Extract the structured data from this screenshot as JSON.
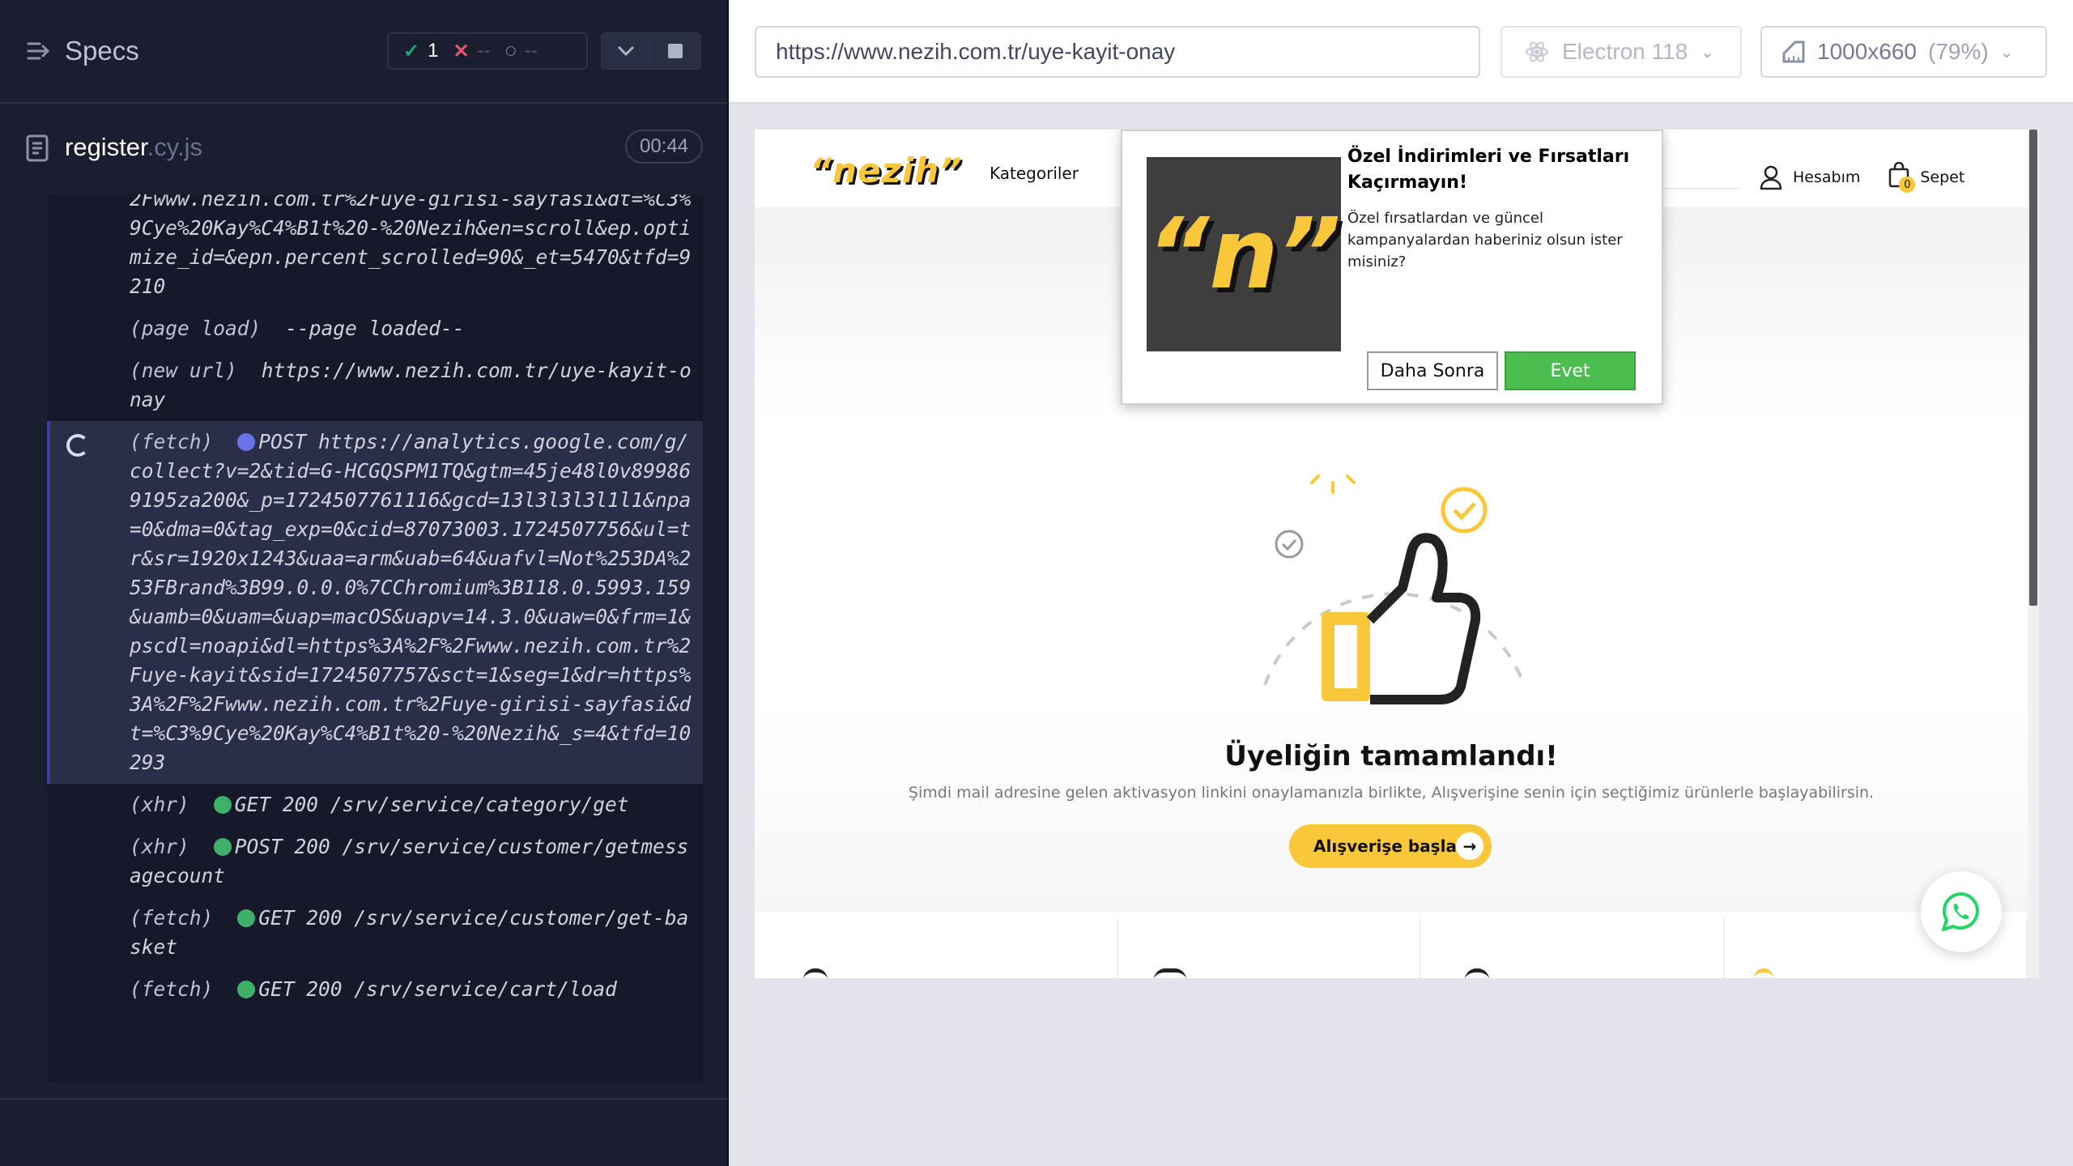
{
  "reporter": {
    "specs_label": "Specs",
    "stats": {
      "passed": "1",
      "failed": "--",
      "pending": "--"
    },
    "spec_file": {
      "name": "register",
      "ext": ".cy.js",
      "duration": "00:44"
    },
    "commands": [
      {
        "name": "",
        "message": "2Fwww.nezih.com.tr%2Fuye-girisi-sayfasi&dt=%C3%9Cye%20Kay%C4%B1t%20-%20Nezih&en=scroll&ep.optimize_id=&epn.percent_scrolled=90&_et=5470&tfd=9210"
      },
      {
        "name": "(page load)",
        "message": "--page loaded--"
      },
      {
        "name": "(new url)",
        "message": "https://www.nezih.com.tr/uye-kayit-onay"
      },
      {
        "name": "(fetch)",
        "method": "POST",
        "dot": "#6c72e8",
        "message": "https://analytics.google.com/g/collect?v=2&tid=G-HCGQSPM1TQ&gtm=45je48l0v899869195za200&_p=1724507761116&gcd=13l3l3l3l1l1&npa=0&dma=0&tag_exp=0&cid=87073003.1724507756&ul=tr&sr=1920x1243&uaa=arm&uab=64&uafvl=Not%253DA%253FBrand%3B99.0.0.0%7CChromium%3B118.0.5993.159&uamb=0&uam=&uap=macOS&uapv=14.3.0&uaw=0&frm=1&pscdl=noapi&dl=https%3A%2F%2Fwww.nezih.com.tr%2Fuye-kayit&sid=1724507757&sct=1&seg=1&dr=https%3A%2F%2Fwww.nezih.com.tr%2Fuye-girisi-sayfasi&dt=%C3%9Cye%20Kay%C4%B1t%20-%20Nezih&_s=4&tfd=10293",
        "active": true
      },
      {
        "name": "(xhr)",
        "method": "GET 200",
        "dot": "#3fb06a",
        "message": "/srv/service/category/get"
      },
      {
        "name": "(xhr)",
        "method": "POST 200",
        "dot": "#3fb06a",
        "message": "/srv/service/customer/getmessagecount"
      },
      {
        "name": "(fetch)",
        "method": "GET 200",
        "dot": "#3fb06a",
        "message": "/srv/service/customer/get-basket"
      },
      {
        "name": "(fetch)",
        "method": "GET 200",
        "dot": "#3fb06a",
        "message": "/srv/service/cart/load"
      }
    ]
  },
  "aut": {
    "url": "https://www.nezih.com.tr/uye-kayit-onay",
    "browser": "Electron 118",
    "viewport": "1000x660",
    "zoom": "(79%)"
  },
  "site": {
    "logo": "“nezih”",
    "nav_categories": "Kategoriler",
    "nav_account": "Hesabım",
    "nav_cart": "Sepet",
    "cart_count": "0",
    "hero_title": "Üyeliğin tamamlandı!",
    "hero_subtitle": "Şimdi mail adresine gelen aktivasyon linkini onaylamanızla birlikte, Alışverişine senin için seçtiğimiz ürünlerle başlayabilirsin.",
    "cta_label": "Alışverişe başla",
    "accent_color": "#f9c83a"
  },
  "popup": {
    "image_text": "“n”",
    "title": "Özel İndirimleri ve Fırsatları Kaçırmayın!",
    "text": "Özel fırsatlardan ve güncel kampanyalardan haberiniz olsun ister misiniz?",
    "later_label": "Daha Sonra",
    "yes_label": "Evet"
  }
}
